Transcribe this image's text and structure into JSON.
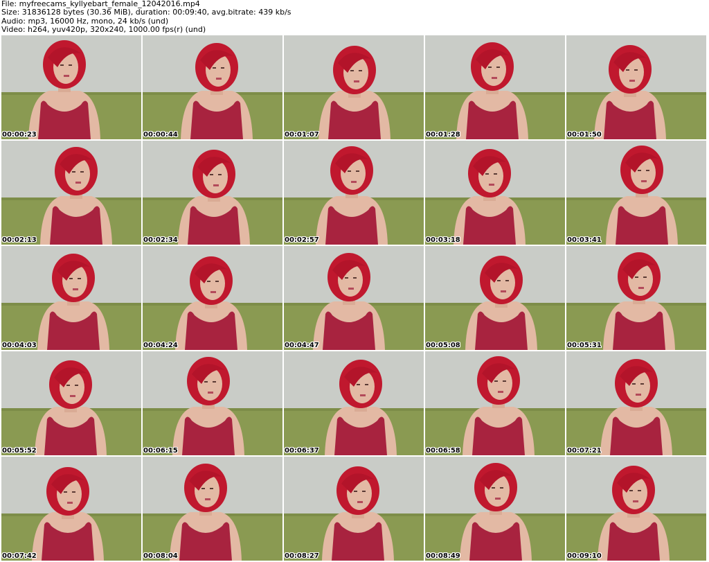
{
  "header": {
    "file_line": "File: myfreecams_kyllyebart_female_12042016.mp4",
    "size_line": "Size: 31836128 bytes (30.36 MiB), duration: 00:09:40, avg.bitrate: 439 kb/s",
    "audio_line": "Audio: mp3, 16000 Hz, mono, 24 kb/s (und)",
    "video_line": "Video: h264, yuv420p, 320x240, 1000.00 fps(r) (und)"
  },
  "colors": {
    "wall": "#c9ccc7",
    "sofa": "#8a9a52",
    "hair": "#c0182e",
    "top": "#a8233f",
    "skin": "#e3b9a4"
  },
  "thumbnails": [
    {
      "timestamp": "00:00:23"
    },
    {
      "timestamp": "00:00:44"
    },
    {
      "timestamp": "00:01:07"
    },
    {
      "timestamp": "00:01:28"
    },
    {
      "timestamp": "00:01:50"
    },
    {
      "timestamp": "00:02:13"
    },
    {
      "timestamp": "00:02:34"
    },
    {
      "timestamp": "00:02:57"
    },
    {
      "timestamp": "00:03:18"
    },
    {
      "timestamp": "00:03:41"
    },
    {
      "timestamp": "00:04:03"
    },
    {
      "timestamp": "00:04:24"
    },
    {
      "timestamp": "00:04:47"
    },
    {
      "timestamp": "00:05:08"
    },
    {
      "timestamp": "00:05:31"
    },
    {
      "timestamp": "00:05:52"
    },
    {
      "timestamp": "00:06:15"
    },
    {
      "timestamp": "00:06:37"
    },
    {
      "timestamp": "00:06:58"
    },
    {
      "timestamp": "00:07:21"
    },
    {
      "timestamp": "00:07:42"
    },
    {
      "timestamp": "00:08:04"
    },
    {
      "timestamp": "00:08:27"
    },
    {
      "timestamp": "00:08:49"
    },
    {
      "timestamp": "00:09:10"
    }
  ]
}
